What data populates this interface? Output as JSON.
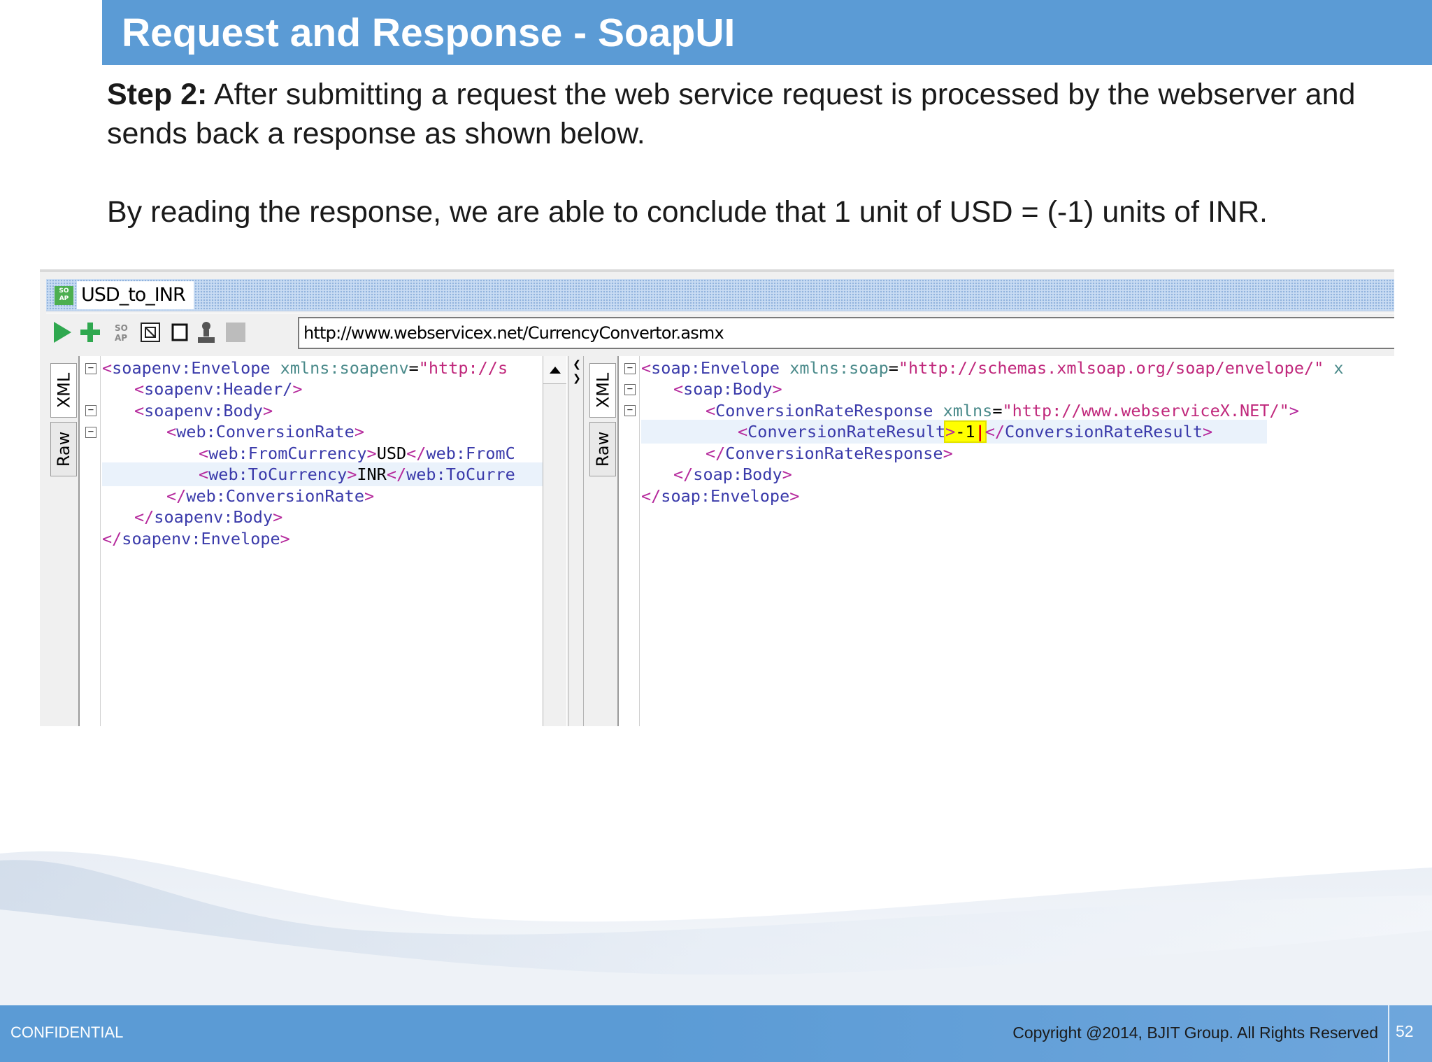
{
  "slide": {
    "title": "Request and Response - SoapUI",
    "step_label": "Step 2:",
    "step_text": " After submitting a request the web service request is processed by the webserver and sends back a response as shown below.",
    "conclusion": "By reading the response, we are able to conclude that 1 unit of USD = (-1) units of INR."
  },
  "soapui": {
    "request_name": "USD_to_INR",
    "logo_text": "SO AP",
    "endpoint_url": "http://www.webservicex.net/CurrencyConvertor.asmx",
    "toolbar_icons": [
      "play-icon",
      "add-icon",
      "soap-icon",
      "refresh-icon",
      "checkbox-icon",
      "user-icon",
      "stop-icon"
    ],
    "left_tabs": [
      "XML",
      "Raw"
    ],
    "right_tabs": [
      "XML",
      "Raw"
    ],
    "request_lines": [
      {
        "open": "<",
        "tag": "soapenv:Envelope",
        "attr": " xmlns:soapenv",
        "eq": "=",
        "val": "\"http://s",
        "close": ""
      },
      {
        "open": "<",
        "tag": "soapenv:Header/",
        "attr": "",
        "eq": "",
        "val": "",
        "close": ">"
      },
      {
        "open": "<",
        "tag": "soapenv:Body",
        "attr": "",
        "eq": "",
        "val": "",
        "close": ">"
      },
      {
        "open": "<",
        "tag": "web:ConversionRate",
        "attr": "",
        "eq": "",
        "val": "",
        "close": ">"
      },
      {
        "open": "<",
        "tag": "web:FromCurrency",
        "close": ">",
        "text": "USD",
        "open2": "</",
        "tag2": "web:FromC"
      },
      {
        "open": "<",
        "tag": "web:ToCurrency",
        "close": ">",
        "text": "INR",
        "open2": "</",
        "tag2": "web:ToCurre"
      },
      {
        "open": "</",
        "tag": "web:ConversionRate",
        "attr": "",
        "eq": "",
        "val": "",
        "close": ">"
      },
      {
        "open": "</",
        "tag": "soapenv:Body",
        "attr": "",
        "eq": "",
        "val": "",
        "close": ">"
      },
      {
        "open": "</",
        "tag": "soapenv:Envelope",
        "attr": "",
        "eq": "",
        "val": "",
        "close": ">"
      }
    ],
    "response_lines": [
      {
        "open": "<",
        "tag": "soap:Envelope",
        "attr": " xmlns:soap",
        "eq": "=",
        "val": "\"http://schemas.xmlsoap.org/soap/envelope/\"",
        "tail": " x"
      },
      {
        "open": "<",
        "tag": "soap:Body",
        "close": ">"
      },
      {
        "open": "<",
        "tag": "ConversionRateResponse",
        "attr": " xmlns",
        "eq": "=",
        "val": "\"http://www.webserviceX.NET/\"",
        "close": ">"
      },
      {
        "open": "<",
        "tag": "ConversionRateResult",
        "close": ">",
        "text": "-1",
        "open2": "</",
        "tag2": "ConversionRateResult",
        "close2": ">"
      },
      {
        "open": "</",
        "tag": "ConversionRateResponse",
        "close": ">"
      },
      {
        "open": "</",
        "tag": "soap:Body",
        "close": ">"
      },
      {
        "open": "</",
        "tag": "soap:Envelope",
        "close": ">"
      }
    ],
    "result_value": "-1"
  },
  "footer": {
    "confidential": "CONFIDENTIAL",
    "copyright": "Copyright @2014, BJIT Group. All Rights Reserved",
    "page_number": "52"
  },
  "colors": {
    "accent": "#5b9bd5",
    "xml_tag": "#b5299c",
    "xml_attr": "#4a8a8a",
    "xml_value": "#c0287c",
    "highlight": "#ffff00"
  }
}
